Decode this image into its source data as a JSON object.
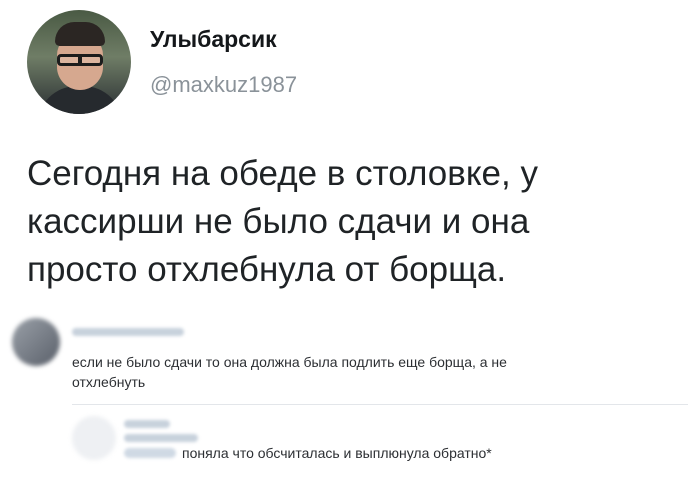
{
  "tweet": {
    "display_name": "Улыбарсик",
    "handle": "@maxkuz1987",
    "text_lines": [
      "Сегодня на обеде в столовке, у",
      "кассирши не было сдачи и она",
      "просто отхлебнула от борща."
    ]
  },
  "comments": [
    {
      "text_lines": [
        "если не было сдачи то она должна была подлить еще борща, а не",
        "отхлебнуть"
      ]
    },
    {
      "text": "поняла что обсчиталась и выплюнула обратно*"
    }
  ]
}
